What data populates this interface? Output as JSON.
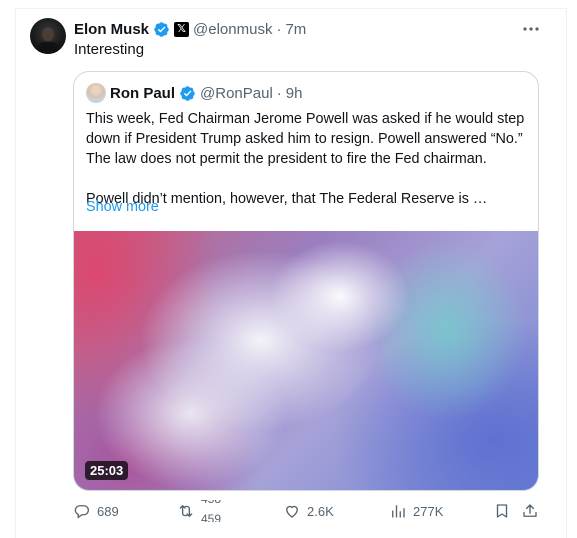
{
  "tweet": {
    "author_name": "Elon Musk",
    "author_handle": "@elonmusk",
    "time": "7m",
    "separator": "·",
    "text": "Interesting",
    "more_icon": "more-icon"
  },
  "quoted": {
    "author_name": "Ron Paul",
    "author_handle": "@RonPaul",
    "time": "9h",
    "separator": "·",
    "paragraph1": "This week, Fed Chairman Jerome Powell was asked if he would step down if President Trump asked him to resign. Powell answered “No.” The law does not permit the president to fire the Fed chairman.",
    "paragraph2": "Powell didn’t mention, however, that The Federal Reserve is …",
    "show_more": "Show more",
    "video_duration": "25:03"
  },
  "actions": {
    "reply_count": "689",
    "repost_count_old": "458",
    "repost_count_new": "459",
    "like_count": "2.6K",
    "views_count": "277K"
  },
  "colors": {
    "verified_blue": "#1d9bf0",
    "link_blue": "#1d9bf0",
    "muted_text": "#536471",
    "border": "#cfd9de"
  }
}
